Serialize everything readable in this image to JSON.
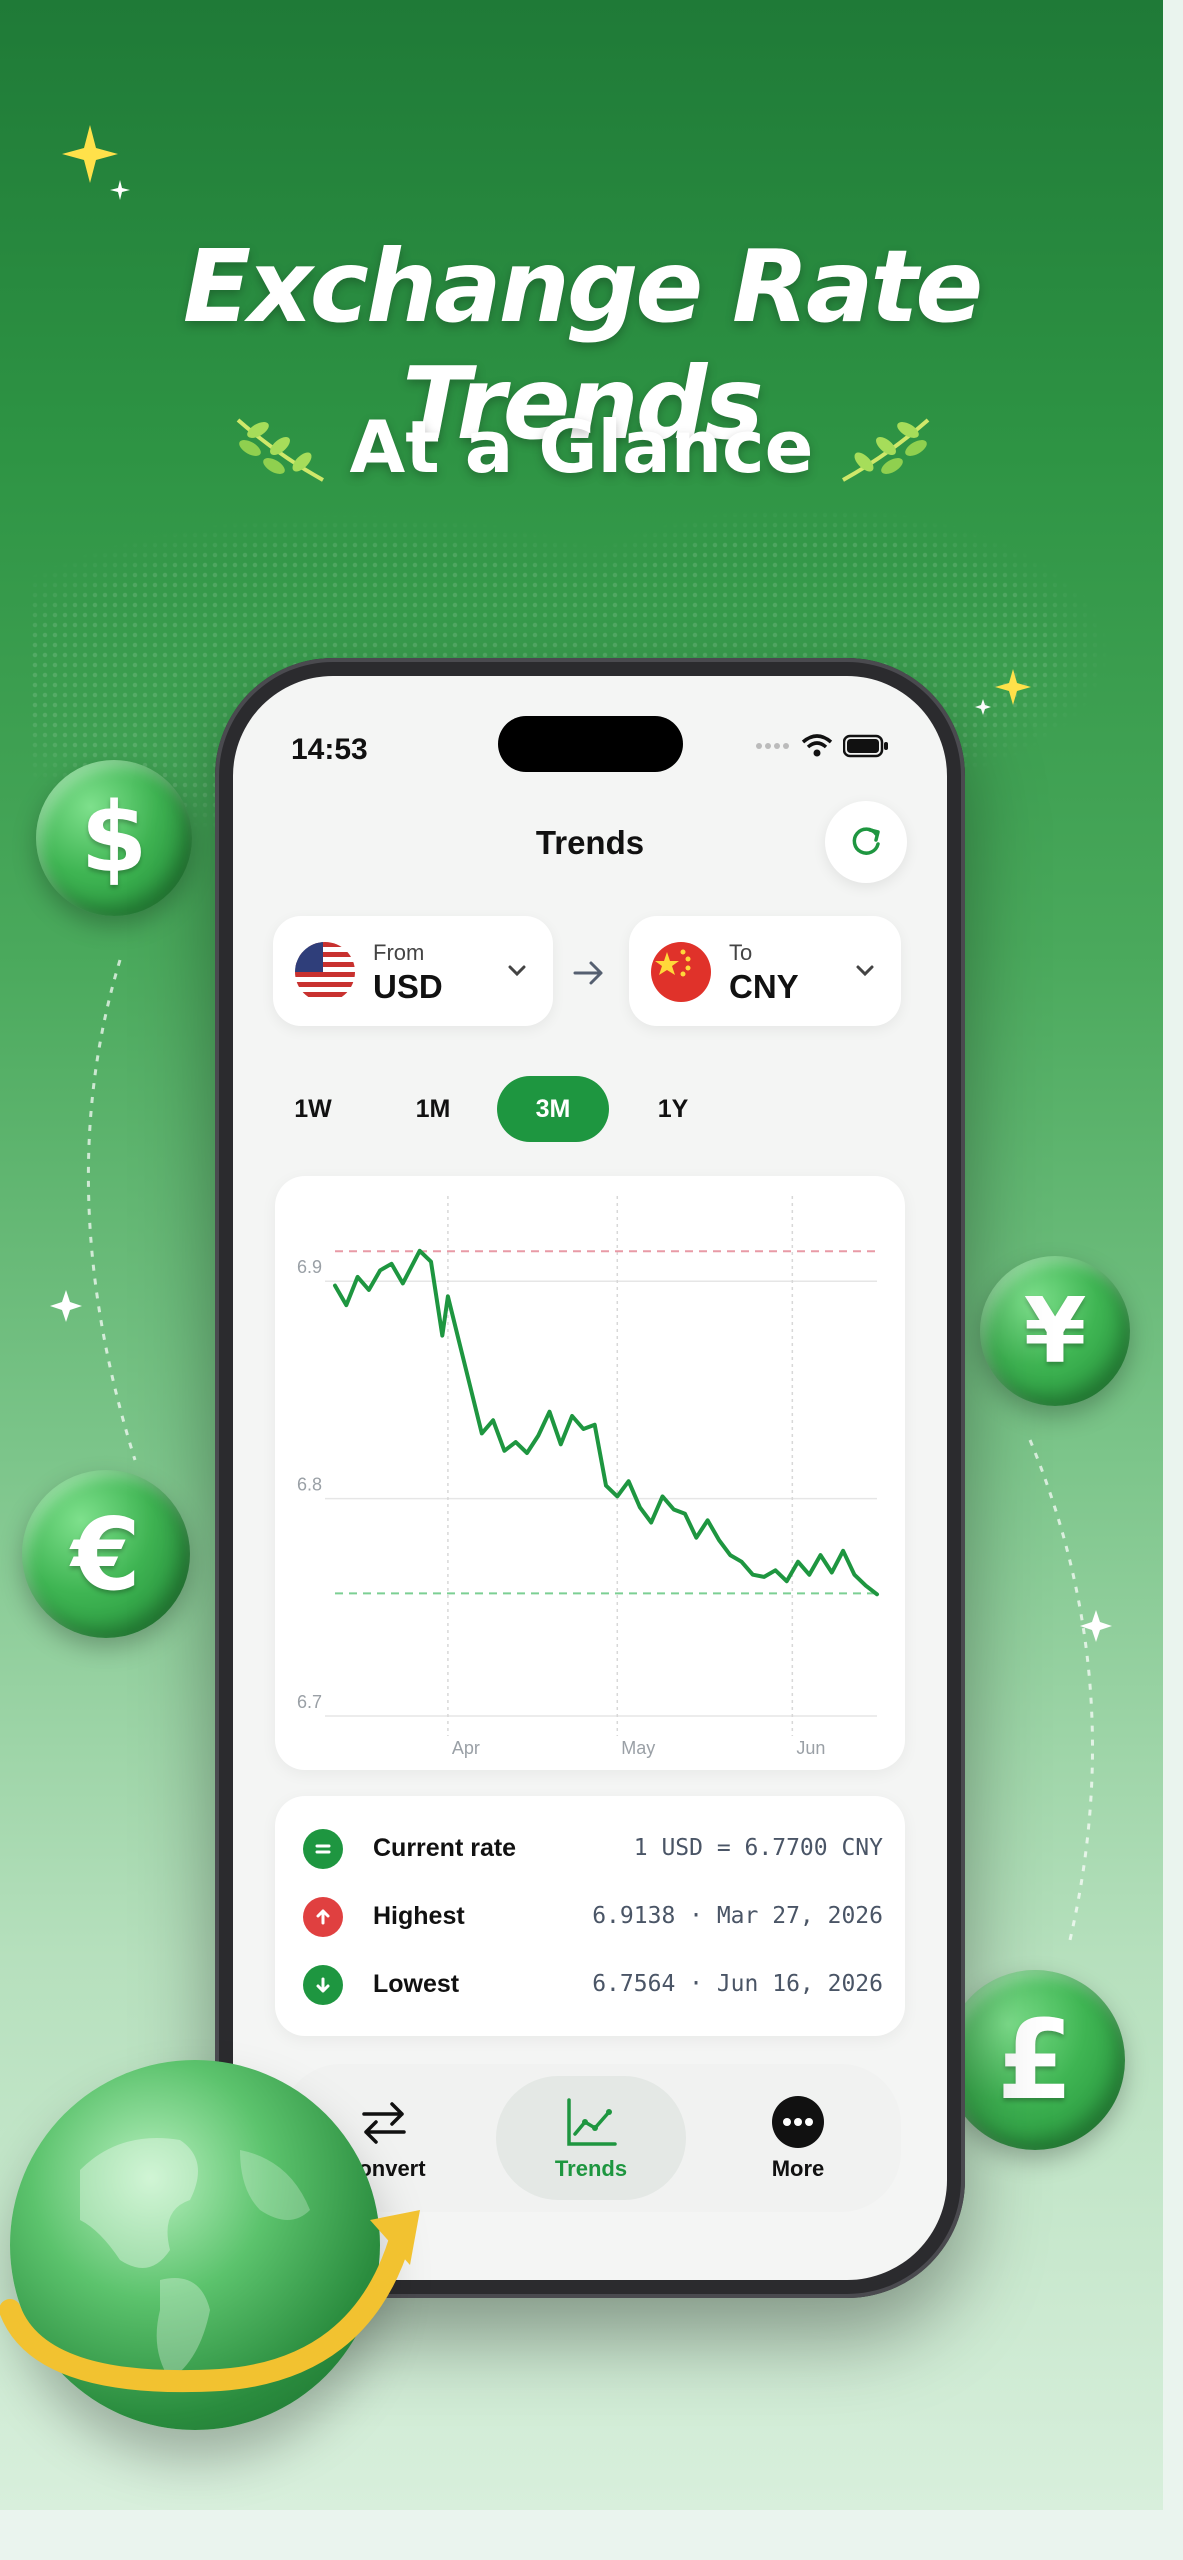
{
  "headline": {
    "line1": "Exchange Rate Trends",
    "line2": "At a Glance"
  },
  "coins": {
    "dollar": "$",
    "euro": "€",
    "yen": "¥",
    "pound": "£"
  },
  "status_bar": {
    "time": "14:53"
  },
  "screen": {
    "title": "Trends",
    "refresh_icon": "refresh-icon",
    "from": {
      "label": "From",
      "code": "USD",
      "flag": "us-flag"
    },
    "to": {
      "label": "To",
      "code": "CNY",
      "flag": "cn-flag"
    },
    "periods": [
      "1W",
      "1M",
      "3M",
      "1Y"
    ],
    "selected_period": "3M"
  },
  "chart_data": {
    "type": "line",
    "x_tick_labels": [
      "Apr",
      "May",
      "Jun"
    ],
    "y_tick_labels": [
      "6.9",
      "6.8",
      "6.7"
    ],
    "ylim": [
      6.7,
      6.93
    ],
    "grid": true,
    "reference_lines": {
      "high": 6.9138,
      "low": 6.7564
    },
    "series": [
      {
        "x": [
          "2026-03-12",
          "2026-03-14",
          "2026-03-16",
          "2026-03-18",
          "2026-03-20",
          "2026-03-22",
          "2026-03-24",
          "2026-03-27",
          "2026-03-29",
          "2026-03-31",
          "2026-04-01",
          "2026-04-03",
          "2026-04-05",
          "2026-04-07",
          "2026-04-09",
          "2026-04-11",
          "2026-04-13",
          "2026-04-15",
          "2026-04-17",
          "2026-04-19",
          "2026-04-21",
          "2026-04-23",
          "2026-04-25",
          "2026-04-27",
          "2026-04-29",
          "2026-05-01",
          "2026-05-03",
          "2026-05-05",
          "2026-05-07",
          "2026-05-09",
          "2026-05-11",
          "2026-05-13",
          "2026-05-15",
          "2026-05-17",
          "2026-05-19",
          "2026-05-21",
          "2026-05-23",
          "2026-05-25",
          "2026-05-27",
          "2026-05-29",
          "2026-05-31",
          "2026-06-02",
          "2026-06-04",
          "2026-06-06",
          "2026-06-08",
          "2026-06-10",
          "2026-06-12",
          "2026-06-14",
          "2026-06-16"
        ],
        "y": [
          6.898,
          6.889,
          6.902,
          6.896,
          6.905,
          6.908,
          6.899,
          6.914,
          6.909,
          6.875,
          6.893,
          6.872,
          6.851,
          6.83,
          6.836,
          6.822,
          6.826,
          6.821,
          6.829,
          6.84,
          6.825,
          6.838,
          6.832,
          6.834,
          6.806,
          6.801,
          6.808,
          6.796,
          6.789,
          6.801,
          6.795,
          6.793,
          6.782,
          6.79,
          6.781,
          6.774,
          6.771,
          6.765,
          6.764,
          6.767,
          6.762,
          6.771,
          6.765,
          6.774,
          6.766,
          6.776,
          6.765,
          6.76,
          6.756
        ]
      }
    ]
  },
  "stats": [
    {
      "label": "Current rate",
      "value": "1 USD = 6.7700 CNY",
      "icon": "equals-icon",
      "color": "#1e9640"
    },
    {
      "label": "Highest",
      "value": "6.9138 · Mar 27, 2026",
      "icon": "arrow-up-icon",
      "color": "#e04040"
    },
    {
      "label": "Lowest",
      "value": "6.7564 · Jun 16, 2026",
      "icon": "arrow-down-icon",
      "color": "#1e9640"
    }
  ],
  "tabs": [
    {
      "label": "Convert",
      "icon": "swap-arrows-icon"
    },
    {
      "label": "Trends",
      "icon": "line-chart-icon"
    },
    {
      "label": "More",
      "icon": "more-dots-icon"
    }
  ],
  "colors": {
    "accent": "#1e9640",
    "high_line": "#e89aa6",
    "low_line": "#7ccf93"
  }
}
